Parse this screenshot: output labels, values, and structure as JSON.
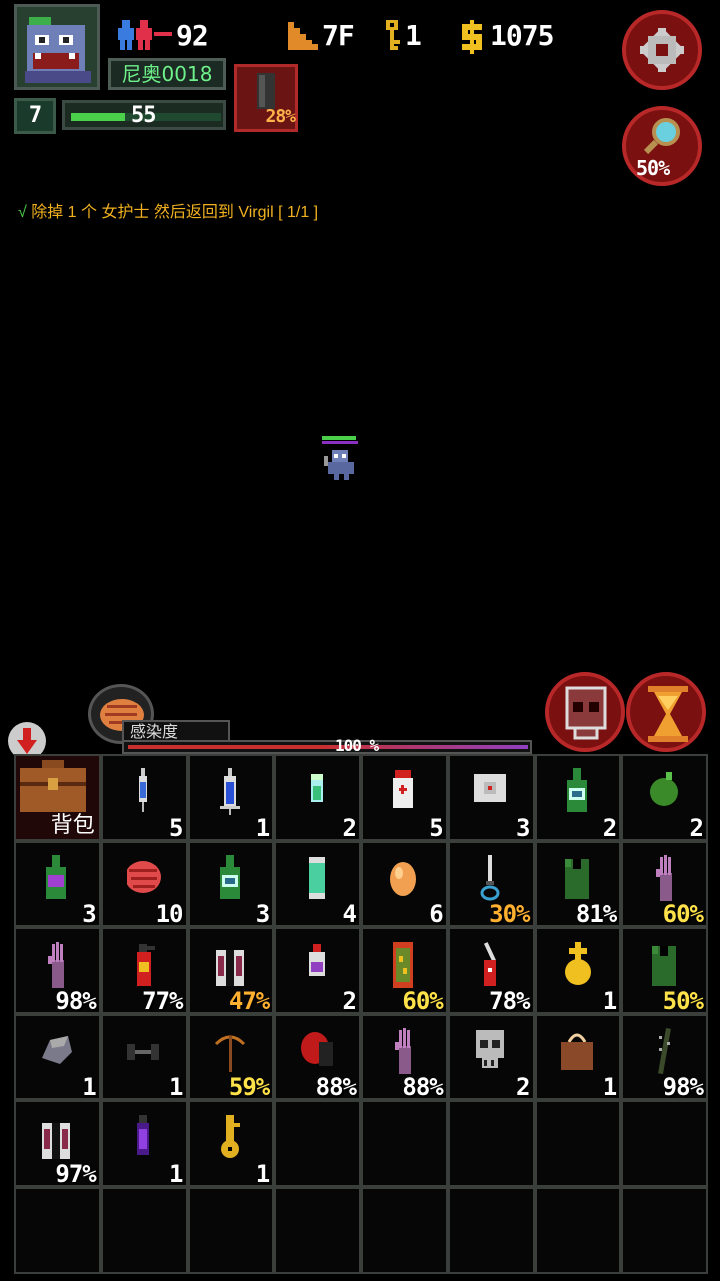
{
  "hud": {
    "level": "7",
    "hp": "55",
    "hp_fraction": 0.36,
    "character_name": "尼奥0018",
    "population": "92",
    "floor": "7F",
    "keys": "1",
    "money": "1075",
    "armor_percent": "28%",
    "search_percent": "50%"
  },
  "quest": {
    "check": "√",
    "text": "除掉 1 个 女护士 然后返回到 Virgil [ 1/1 ]"
  },
  "infection": {
    "label": "感染度",
    "percent": "100 %",
    "value": 1.0
  },
  "bag": {
    "label": "背包"
  },
  "inventory": [
    {
      "icon": "syringe-small-icon",
      "count": "5",
      "color": "white"
    },
    {
      "icon": "syringe-blue-icon",
      "count": "1",
      "color": "white"
    },
    {
      "icon": "vial-green-icon",
      "count": "2",
      "color": "white"
    },
    {
      "icon": "pill-bottle-red-icon",
      "count": "5",
      "color": "white"
    },
    {
      "icon": "bandage-icon",
      "count": "3",
      "color": "white"
    },
    {
      "icon": "bottle-green-icon",
      "count": "2",
      "color": "white"
    },
    {
      "icon": "green-fruit-icon",
      "count": "2",
      "color": "white"
    },
    {
      "icon": "bottle-purple-icon",
      "count": "3",
      "color": "white"
    },
    {
      "icon": "brain-icon",
      "count": "10",
      "color": "white"
    },
    {
      "icon": "bottle-green-icon",
      "count": "3",
      "color": "white"
    },
    {
      "icon": "capsule-green-icon",
      "count": "4",
      "color": "white"
    },
    {
      "icon": "egg-icon",
      "count": "6",
      "color": "white"
    },
    {
      "icon": "knife-icon",
      "count": "30%",
      "color": "orange"
    },
    {
      "icon": "green-vest-icon",
      "count": "81%",
      "color": "white"
    },
    {
      "icon": "zombie-hand-icon",
      "count": "60%",
      "color": "yellow"
    },
    {
      "icon": "zombie-hand-icon",
      "count": "98%",
      "color": "white"
    },
    {
      "icon": "fire-extinguisher-icon",
      "count": "77%",
      "color": "white"
    },
    {
      "icon": "jacket-icon",
      "count": "47%",
      "color": "orange"
    },
    {
      "icon": "potion-purple-icon",
      "count": "2",
      "color": "white"
    },
    {
      "icon": "riot-shield-icon",
      "count": "60%",
      "color": "yellow"
    },
    {
      "icon": "swiss-knife-icon",
      "count": "78%",
      "color": "white"
    },
    {
      "icon": "golden-cross-icon",
      "count": "1",
      "color": "white"
    },
    {
      "icon": "green-vest-icon",
      "count": "50%",
      "color": "yellow"
    },
    {
      "icon": "stone-icon",
      "count": "1",
      "color": "white"
    },
    {
      "icon": "dumbbell-icon",
      "count": "1",
      "color": "white"
    },
    {
      "icon": "crossbow-icon",
      "count": "59%",
      "color": "yellow"
    },
    {
      "icon": "boxing-glove-icon",
      "count": "88%",
      "color": "white"
    },
    {
      "icon": "zombie-hand-icon",
      "count": "88%",
      "color": "white"
    },
    {
      "icon": "skull-icon",
      "count": "2",
      "color": "white"
    },
    {
      "icon": "handbag-icon",
      "count": "1",
      "color": "white"
    },
    {
      "icon": "spiked-bat-icon",
      "count": "98%",
      "color": "white"
    },
    {
      "icon": "jacket-icon",
      "count": "97%",
      "color": "white"
    },
    {
      "icon": "purple-vial-icon",
      "count": "1",
      "color": "white"
    },
    {
      "icon": "gold-key-icon",
      "count": "1",
      "color": "white"
    },
    {
      "icon": "",
      "count": "",
      "color": "white"
    },
    {
      "icon": "",
      "count": "",
      "color": "white"
    },
    {
      "icon": "",
      "count": "",
      "color": "white"
    },
    {
      "icon": "",
      "count": "",
      "color": "white"
    },
    {
      "icon": "",
      "count": "",
      "color": "white"
    },
    {
      "icon": "",
      "count": "",
      "color": "white"
    },
    {
      "icon": "",
      "count": "",
      "color": "white"
    },
    {
      "icon": "",
      "count": "",
      "color": "white"
    },
    {
      "icon": "",
      "count": "",
      "color": "white"
    },
    {
      "icon": "",
      "count": "",
      "color": "white"
    },
    {
      "icon": "",
      "count": "",
      "color": "white"
    },
    {
      "icon": "",
      "count": "",
      "color": "white"
    },
    {
      "icon": "",
      "count": "",
      "color": "white"
    }
  ],
  "colors": {
    "accent_red": "#b82828",
    "hp_green": "#4ad04a",
    "name_green": "#6ef08a",
    "quest_yellow": "#f0b020",
    "count_yellow": "#ffe24a",
    "count_orange": "#ffb030"
  }
}
